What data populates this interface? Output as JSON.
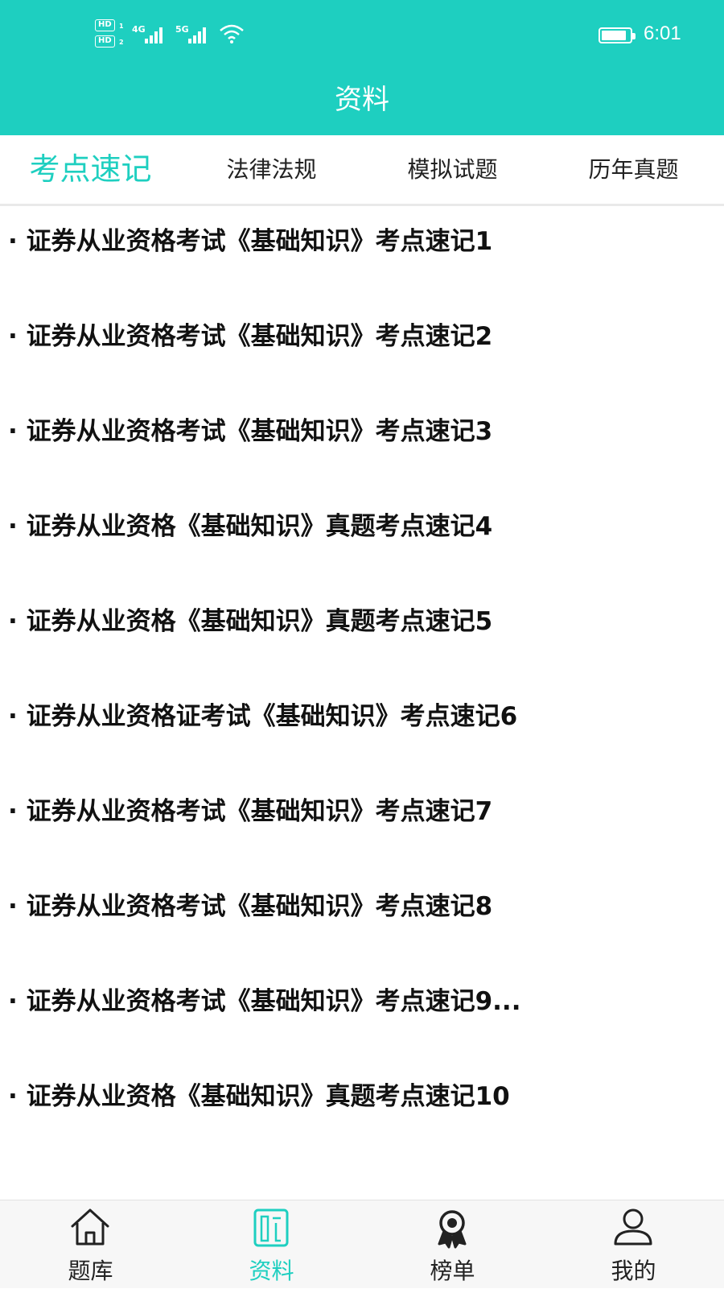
{
  "colors": {
    "accent": "#1ecfc0",
    "text": "#111111",
    "nav_bg": "#f7f7f7"
  },
  "status_bar": {
    "sim1": "HD",
    "sim1_index": "1",
    "sim2": "HD",
    "sim2_index": "2",
    "network1": "4G",
    "network2": "5G",
    "time": "6:01",
    "icons": [
      "signal-icon",
      "wifi-icon",
      "battery-icon"
    ]
  },
  "header": {
    "title": "资料"
  },
  "tabs": [
    {
      "label": "考点速记",
      "active": true
    },
    {
      "label": "法律法规",
      "active": false
    },
    {
      "label": "模拟试题",
      "active": false
    },
    {
      "label": "历年真题",
      "active": false
    }
  ],
  "list": {
    "items": [
      "· 证券从业资格考试《基础知识》考点速记1",
      "· 证券从业资格考试《基础知识》考点速记2",
      "· 证券从业资格考试《基础知识》考点速记3",
      "· 证券从业资格《基础知识》真题考点速记4",
      "· 证券从业资格《基础知识》真题考点速记5",
      "· 证券从业资格证考试《基础知识》考点速记6",
      "· 证券从业资格考试《基础知识》考点速记7",
      "· 证券从业资格考试《基础知识》考点速记8",
      "· 证券从业资格考试《基础知识》考点速记9...",
      "· 证券从业资格《基础知识》真题考点速记10"
    ]
  },
  "bottom_nav": [
    {
      "label": "题库",
      "icon": "home-icon",
      "active": false
    },
    {
      "label": "资料",
      "icon": "document-icon",
      "active": true
    },
    {
      "label": "榜单",
      "icon": "award-icon",
      "active": false
    },
    {
      "label": "我的",
      "icon": "user-icon",
      "active": false
    }
  ]
}
